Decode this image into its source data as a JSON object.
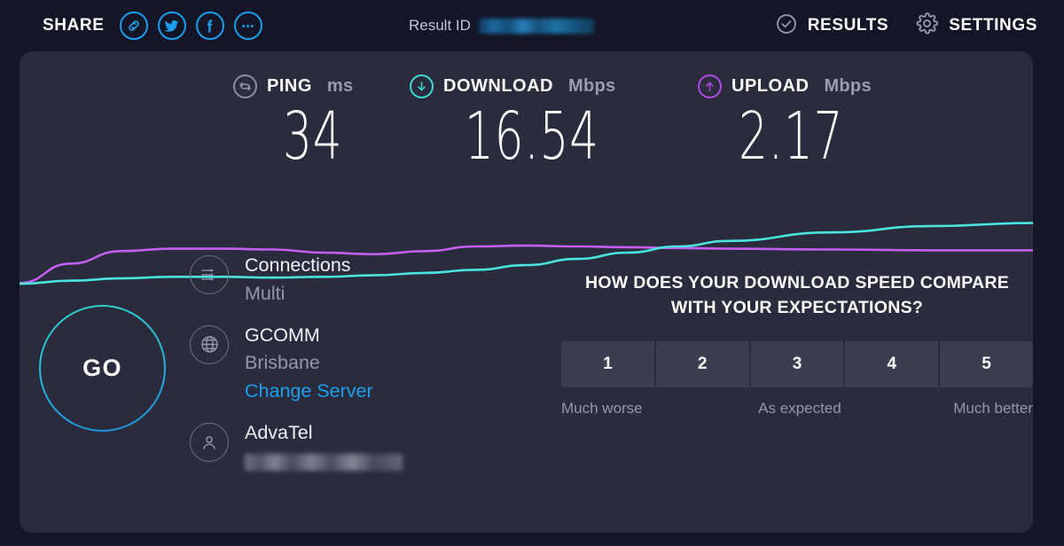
{
  "header": {
    "share_label": "SHARE",
    "share_icons": [
      {
        "name": "link-icon",
        "title": "Copy link"
      },
      {
        "name": "twitter-icon",
        "title": "Share on Twitter"
      },
      {
        "name": "facebook-icon",
        "title": "Share on Facebook"
      },
      {
        "name": "more-icon",
        "title": "More share options"
      }
    ],
    "result_id_label": "Result ID",
    "result_id_value": "",
    "results_label": "RESULTS",
    "settings_label": "SETTINGS",
    "results_icon": "check-circle-icon",
    "settings_icon": "gear-icon"
  },
  "metrics": {
    "ping": {
      "name": "PING",
      "unit": "ms",
      "value": "34",
      "icon": "ping-icon",
      "color": "#8b8fa6"
    },
    "download": {
      "name": "DOWNLOAD",
      "unit": "Mbps",
      "value": "16.54",
      "icon": "download-arrow-icon",
      "color": "#3eddd4"
    },
    "upload": {
      "name": "UPLOAD",
      "unit": "Mbps",
      "value": "2.17",
      "icon": "upload-arrow-icon",
      "color": "#b14ce8"
    }
  },
  "chart_data": {
    "type": "line",
    "title": "",
    "xlabel": "",
    "ylabel": "",
    "grid": false,
    "legend": "none",
    "x": [
      0,
      0.05,
      0.1,
      0.15,
      0.2,
      0.25,
      0.3,
      0.35,
      0.4,
      0.45,
      0.5,
      0.55,
      0.6,
      0.65,
      0.7,
      0.8,
      0.9,
      1.0
    ],
    "series": [
      {
        "name": "Download",
        "color": "#49e4dd",
        "values": [
          0.02,
          0.06,
          0.09,
          0.11,
          0.11,
          0.1,
          0.11,
          0.13,
          0.16,
          0.2,
          0.26,
          0.34,
          0.42,
          0.5,
          0.57,
          0.68,
          0.76,
          0.8
        ]
      },
      {
        "name": "Upload",
        "color": "#c45ef0",
        "values": [
          0.03,
          0.28,
          0.44,
          0.47,
          0.47,
          0.46,
          0.42,
          0.4,
          0.44,
          0.5,
          0.51,
          0.5,
          0.49,
          0.48,
          0.47,
          0.46,
          0.45,
          0.45
        ]
      }
    ]
  },
  "go_button": {
    "label": "GO"
  },
  "info": [
    {
      "icon": "multi-connection-icon",
      "title": "Connections",
      "sub": "Multi",
      "link": null,
      "redacted": false
    },
    {
      "icon": "globe-icon",
      "title": "GCOMM",
      "sub": "Brisbane",
      "link": "Change Server",
      "redacted": false
    },
    {
      "icon": "person-icon",
      "title": "AdvaTel",
      "sub": null,
      "link": null,
      "redacted": true
    }
  ],
  "survey": {
    "heading_line1": "HOW DOES YOUR DOWNLOAD SPEED COMPARE",
    "heading_line2": "WITH YOUR EXPECTATIONS?",
    "ratings": [
      "1",
      "2",
      "3",
      "4",
      "5"
    ],
    "label_low": "Much worse",
    "label_mid": "As expected",
    "label_high": "Much better"
  },
  "colors": {
    "page_background": "#141527",
    "card_background": "#2a2b3d",
    "accent_blue": "#1a9fee",
    "download": "#3eddd4",
    "upload": "#b14ce8",
    "muted_text": "#9397ae"
  }
}
